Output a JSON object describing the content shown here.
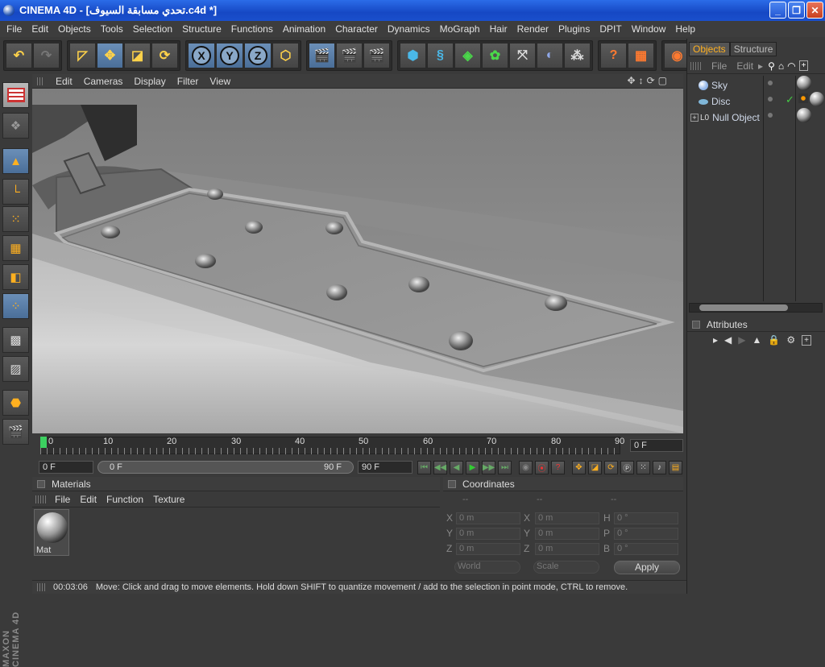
{
  "window": {
    "title": "CINEMA 4D - [تحدي مسابقة السيوف.c4d *]",
    "minimize": "_",
    "maximize": "❐",
    "close": "✕"
  },
  "menubar": [
    "File",
    "Edit",
    "Objects",
    "Tools",
    "Selection",
    "Structure",
    "Functions",
    "Animation",
    "Character",
    "Dynamics",
    "MoGraph",
    "Hair",
    "Render",
    "Plugins",
    "DPIT",
    "Window",
    "Help"
  ],
  "axis_buttons": [
    "X",
    "Y",
    "Z"
  ],
  "viewport_menu": [
    "Edit",
    "Cameras",
    "Display",
    "Filter",
    "View"
  ],
  "timeline": {
    "ticks": [
      "0",
      "10",
      "20",
      "30",
      "40",
      "50",
      "60",
      "70",
      "80",
      "90"
    ],
    "current_frame_field": "0 F",
    "start_field": "0 F",
    "range_start": "0 F",
    "range_end": "90 F",
    "end_field": "90 F"
  },
  "materials": {
    "title": "Materials",
    "menu": [
      "File",
      "Edit",
      "Function",
      "Texture"
    ],
    "items": [
      {
        "label": "Mat"
      }
    ]
  },
  "coordinates": {
    "title": "Coordinates",
    "headers": [
      "--",
      "--",
      "--"
    ],
    "rows": [
      {
        "l1": "X",
        "v1": "0 m",
        "l2": "X",
        "v2": "0 m",
        "l3": "H",
        "v3": "0 °"
      },
      {
        "l1": "Y",
        "v1": "0 m",
        "l2": "Y",
        "v2": "0 m",
        "l3": "P",
        "v3": "0 °"
      },
      {
        "l1": "Z",
        "v1": "0 m",
        "l2": "Z",
        "v2": "0 m",
        "l3": "B",
        "v3": "0 °"
      }
    ],
    "mode1": "World",
    "mode2": "Scale",
    "apply": "Apply"
  },
  "status": {
    "time": "00:03:06",
    "message": "Move: Click and drag to move elements. Hold down SHIFT to quantize movement / add to the selection in point mode, CTRL to remove."
  },
  "objects_panel": {
    "tabs": [
      "Objects",
      "Structure"
    ],
    "menu": [
      "File",
      "Edit"
    ],
    "items": [
      {
        "name": "Sky",
        "color": "#8fb4e8"
      },
      {
        "name": "Disc",
        "color": "#7fb6d8"
      },
      {
        "name": "Null Object",
        "color": "#dddddd"
      }
    ],
    "null_icon_text": "L0"
  },
  "attributes": {
    "title": "Attributes"
  },
  "brand": "MAXON CINEMA 4D",
  "colors": {
    "accent": "#ffb020",
    "title_blue": "#1648c4",
    "viewport": "#8a8a8a"
  }
}
